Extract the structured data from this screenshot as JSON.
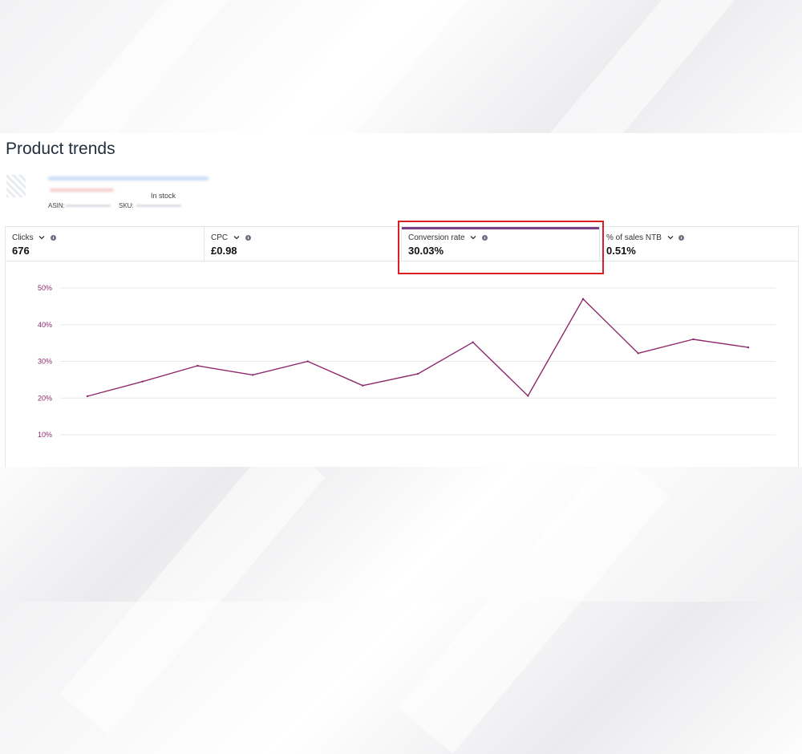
{
  "page": {
    "title": "Product trends"
  },
  "product": {
    "stock": "In stock",
    "asin_label": "ASIN:",
    "sku_label": "SKU:"
  },
  "metrics": [
    {
      "label": "Clicks",
      "value": "676"
    },
    {
      "label": "CPC",
      "value": "£0.98"
    },
    {
      "label": "Conversion rate",
      "value": "30.03%",
      "active": true
    },
    {
      "label": "% of sales NTB",
      "value": "0.51%"
    }
  ],
  "colors": {
    "series": "#8e2a6b",
    "active_bar": "#7a3e86",
    "highlight": "#d91e24",
    "tick_label": "#8e2a6b"
  },
  "chart_data": {
    "type": "line",
    "ylim": [
      0,
      50
    ],
    "yticks": [
      "50%",
      "40%",
      "30%",
      "20%",
      "10%"
    ],
    "grid": true,
    "series": [
      {
        "values": [
          20.5,
          24.5,
          28.8,
          26.3,
          30.0,
          23.4,
          26.6,
          35.2,
          20.6,
          47.0,
          32.2,
          36.0,
          33.8
        ]
      }
    ]
  }
}
